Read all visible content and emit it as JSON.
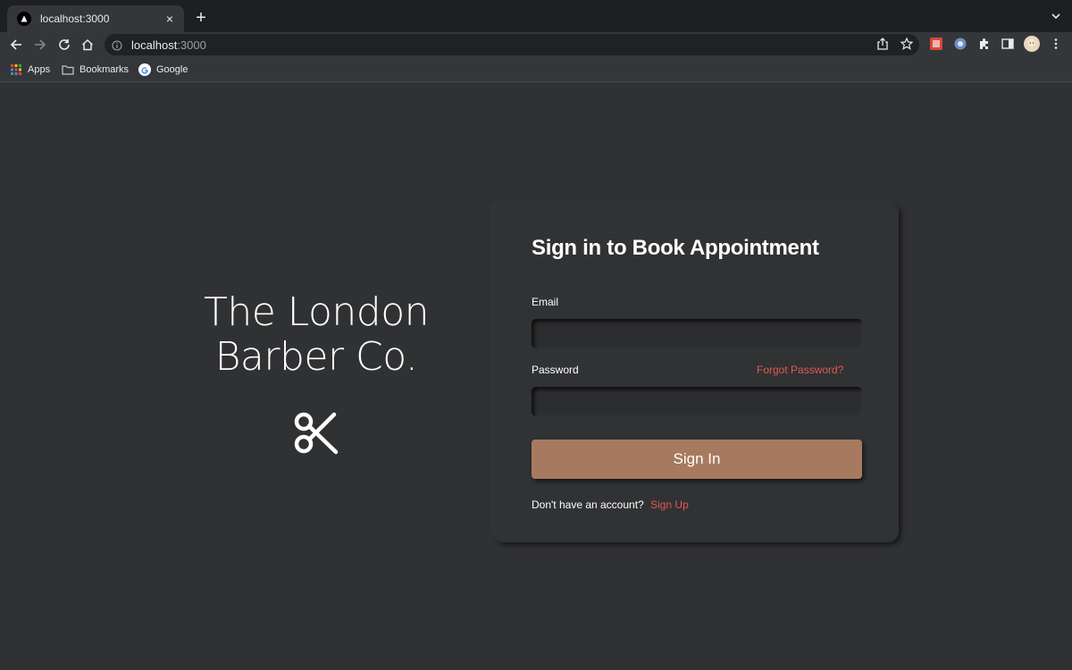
{
  "browser": {
    "tab_title": "localhost:3000",
    "tab_close": "×",
    "new_tab": "+",
    "url_host": "localhost",
    "url_port": ":3000",
    "bookmarks": [
      {
        "label": "Apps",
        "icon": "apps-grid-icon"
      },
      {
        "label": "Bookmarks",
        "icon": "folder-icon"
      },
      {
        "label": "Google",
        "icon": "google-icon"
      }
    ]
  },
  "brand": {
    "line1": "The London",
    "line2": "Barber Co.",
    "icon": "scissors-icon"
  },
  "signin": {
    "title": "Sign in to Book Appointment",
    "email_label": "Email",
    "email_value": "",
    "password_label": "Password",
    "password_value": "",
    "forgot_label": "Forgot Password?",
    "button_label": "Sign In",
    "no_account_text": "Don't have an account?",
    "signup_label": "Sign Up"
  },
  "colors": {
    "page_bg": "#303133",
    "button": "#a77a5f",
    "link": "#e0584f"
  }
}
